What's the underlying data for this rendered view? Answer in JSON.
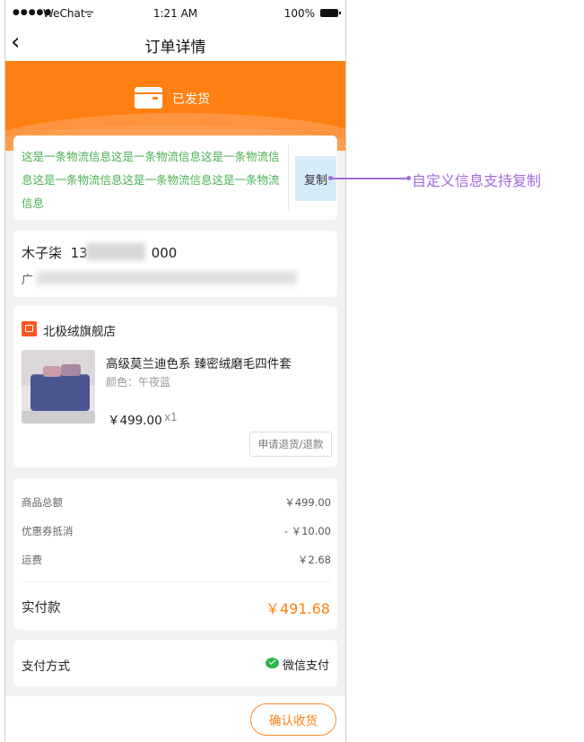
{
  "status_bar": {
    "signal": "●●●●●",
    "carrier": "WeChat",
    "wifi": "ᯤ",
    "time": "1:21 AM",
    "battery": "100%"
  },
  "nav": {
    "back": "‹",
    "title": "订单详情"
  },
  "hero": {
    "status": "已发货",
    "icon": "shipping-box-icon",
    "color": "#ff7f12"
  },
  "logistics": {
    "info": "这是一条物流信息这是一条物流信息这是一条物流信息这是一条物流信息这是一条物流信息这是一条物流信息",
    "copy_label": "复制"
  },
  "address": {
    "name": "木子柒",
    "phone_start": "13",
    "phone_end": "000",
    "address_prefix": "广"
  },
  "order": {
    "shop_name": "北极绒旗舰店",
    "shop_icon": "shop-icon",
    "product_name": "高级莫兰迪色系  臻密绒磨毛四件套",
    "product_attr": "颜色：午夜蓝",
    "price": "￥499.00",
    "qty": "x1",
    "refund_label": "申请退货/退款"
  },
  "summary": {
    "rows": [
      {
        "label": "商品总额",
        "value": "￥499.00"
      },
      {
        "label": "优惠券抵消",
        "value": "- ￥10.00"
      },
      {
        "label": "运费",
        "value": "￥2.68"
      }
    ],
    "paid_label": "实付款",
    "paid_value": "￥491.68"
  },
  "payment": {
    "label": "支付方式",
    "method": "微信支付",
    "icon": "wechat-pay-icon"
  },
  "bottom": {
    "confirm_label": "确认收货"
  },
  "annotation": {
    "text": "自定义信息支持复制",
    "color": "#a46ad8"
  }
}
